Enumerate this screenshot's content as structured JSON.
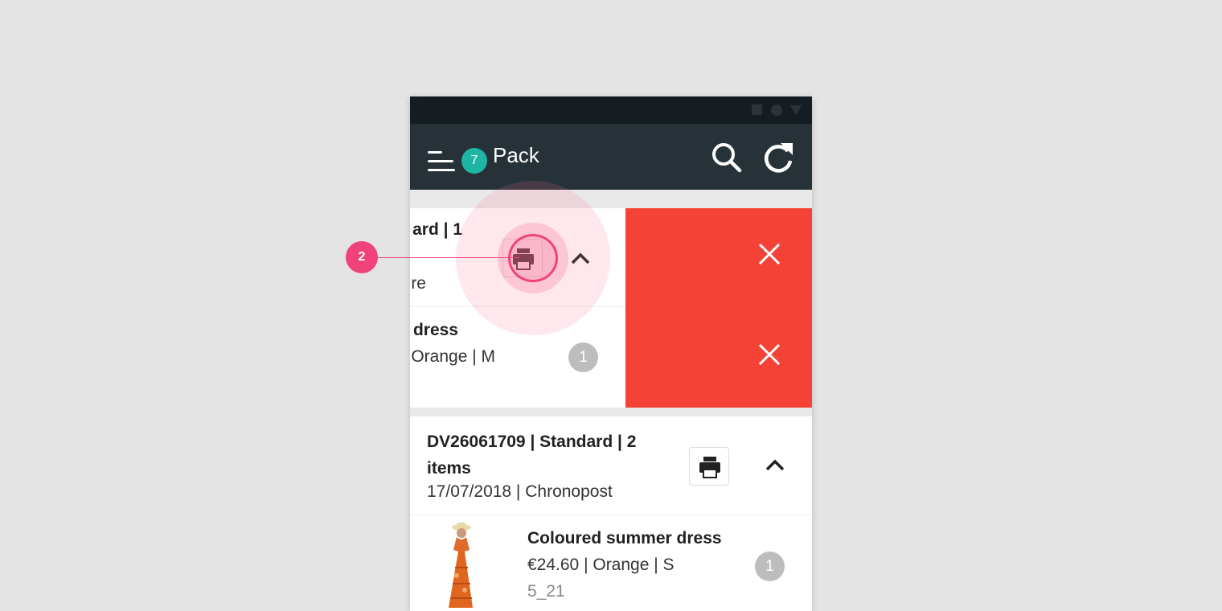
{
  "app": {
    "title": "Pack",
    "menu_badge": "7"
  },
  "orders": [
    {
      "header_visible": "ard | 1",
      "carrier_visible": "re",
      "item": {
        "name_visible": "dress",
        "detail_visible": "Orange | M",
        "qty": "1"
      }
    },
    {
      "header_line1": "DV26061709 | Standard | 2",
      "header_line2": "items",
      "meta": "17/07/2018 | Chronopost",
      "item": {
        "name": "Coloured summer dress",
        "detail": "€24.60 | Orange | S",
        "sku": "5_21",
        "qty": "1"
      }
    }
  ],
  "annotation": {
    "number": "2"
  },
  "colors": {
    "statusbar": "#161d22",
    "appbar": "#263238",
    "badge": "#1fb5a5",
    "delete": "#f44336",
    "annotation": "#f0427a",
    "qty_badge": "#bdbdbd"
  },
  "icons": [
    "menu-icon",
    "search-icon",
    "refresh-icon",
    "print-icon",
    "chevron-up-icon",
    "close-icon"
  ]
}
